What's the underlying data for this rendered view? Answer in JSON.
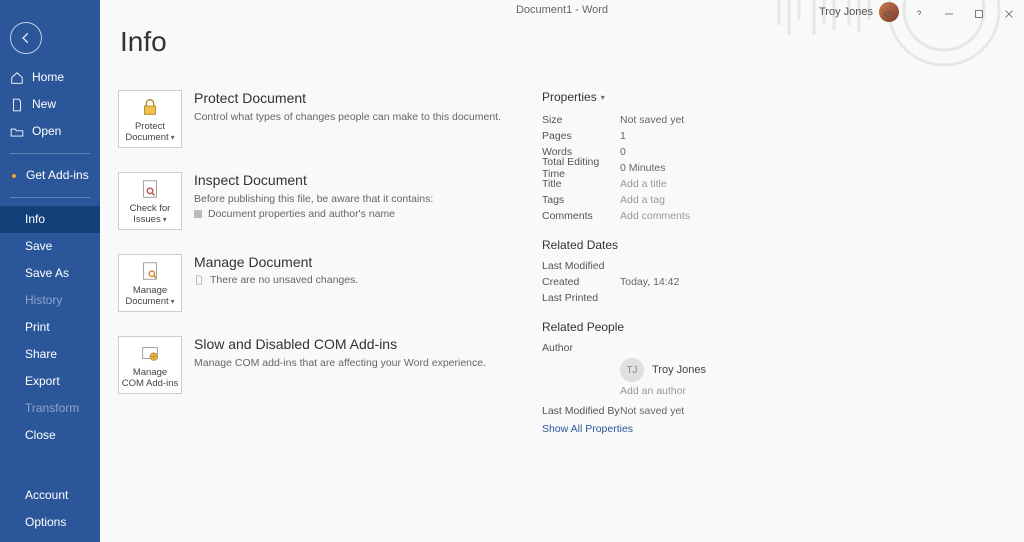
{
  "window": {
    "title": "Document1  -  Word",
    "user_name": "Troy Jones"
  },
  "sidebar": {
    "back_label": "Back",
    "top": [
      {
        "label": "Home"
      },
      {
        "label": "New"
      },
      {
        "label": "Open"
      }
    ],
    "addins": {
      "label": "Get Add-ins"
    },
    "mid": [
      {
        "label": "Info",
        "selected": true
      },
      {
        "label": "Save"
      },
      {
        "label": "Save As"
      },
      {
        "label": "History",
        "disabled": true
      },
      {
        "label": "Print"
      },
      {
        "label": "Share"
      },
      {
        "label": "Export"
      },
      {
        "label": "Transform",
        "disabled": true
      },
      {
        "label": "Close"
      }
    ],
    "bottom": [
      {
        "label": "Account"
      },
      {
        "label": "Options"
      }
    ]
  },
  "page": {
    "title": "Info",
    "tiles": [
      {
        "button": "Protect Document",
        "has_caret": true,
        "heading": "Protect Document",
        "desc": "Control what types of changes people can make to this document."
      },
      {
        "button": "Check for Issues",
        "has_caret": true,
        "heading": "Inspect Document",
        "desc": "Before publishing this file, be aware that it contains:",
        "sub": "Document properties and author's name",
        "sub_kind": "bullet"
      },
      {
        "button": "Manage Document",
        "has_caret": true,
        "heading": "Manage Document",
        "sub": "There are no unsaved changes.",
        "sub_kind": "icon"
      },
      {
        "button": "Manage COM Add-ins",
        "has_caret": false,
        "heading": "Slow and Disabled COM Add-ins",
        "desc": "Manage COM add-ins that are affecting your Word experience."
      }
    ]
  },
  "properties": {
    "heading": "Properties",
    "rows": [
      {
        "label": "Size",
        "value": "Not saved yet"
      },
      {
        "label": "Pages",
        "value": "1"
      },
      {
        "label": "Words",
        "value": "0"
      },
      {
        "label": "Total Editing Time",
        "value": "0 Minutes"
      },
      {
        "label": "Title",
        "value": "Add a title",
        "placeholder": true
      },
      {
        "label": "Tags",
        "value": "Add a tag",
        "placeholder": true
      },
      {
        "label": "Comments",
        "value": "Add comments",
        "placeholder": true
      }
    ],
    "related_dates": {
      "heading": "Related Dates",
      "rows": [
        {
          "label": "Last Modified",
          "value": ""
        },
        {
          "label": "Created",
          "value": "Today, 14:42"
        },
        {
          "label": "Last Printed",
          "value": ""
        }
      ]
    },
    "related_people": {
      "heading": "Related People",
      "author_label": "Author",
      "author_initials": "TJ",
      "author_name": "Troy Jones",
      "add_author": "Add an author",
      "last_modified_by_label": "Last Modified By",
      "last_modified_by_value": "Not saved yet"
    },
    "show_all": "Show All Properties"
  }
}
